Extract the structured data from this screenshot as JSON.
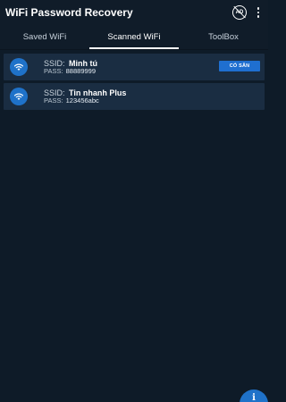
{
  "app": {
    "title": "WiFi Password Recovery"
  },
  "appbar_icons": {
    "ad_icon": "no-ads-icon",
    "ad_text": "AD",
    "more_icon": "more-vert-icon"
  },
  "tabs": [
    {
      "label": "Saved WiFi",
      "active": false
    },
    {
      "label": "Scanned WiFi",
      "active": true
    },
    {
      "label": "ToolBox",
      "active": false
    }
  ],
  "networks": [
    {
      "ssid_label": "SSID:",
      "ssid": "Minh tú",
      "pass_label": "PASS:",
      "pass": "88889999",
      "badge": "CÓ SẴN",
      "icon": "wifi-icon"
    },
    {
      "ssid_label": "SSID:",
      "ssid": "Tin nhanh Plus",
      "pass_label": "PASS:",
      "pass": "123456abc",
      "icon": "wifi-icon"
    }
  ],
  "fab": {
    "icon": "info-icon",
    "glyph": "i"
  },
  "colors": {
    "background": "#0e1b28",
    "row": "#1a2d42",
    "accent": "#1f72c9"
  }
}
